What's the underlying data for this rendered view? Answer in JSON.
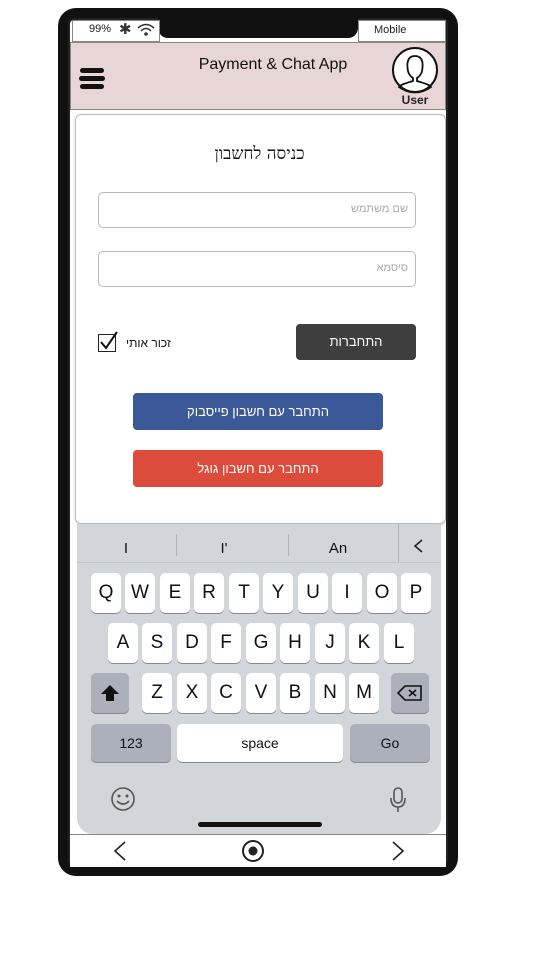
{
  "status_bar": {
    "battery": "99%",
    "network": "Mobile"
  },
  "header": {
    "title": "Payment & Chat App",
    "user_label": "User"
  },
  "login": {
    "title": "כניסה לחשבון",
    "username_placeholder": "שם משתמש",
    "password_placeholder": "סיסמא",
    "login_button": "התחברות",
    "remember_me": "זכור אותי",
    "remember_checked": true,
    "facebook_button": "התחבר עם חשבון פייסבוק",
    "google_button": "התחבר עם חשבון גוגל"
  },
  "colors": {
    "header_bg": "#e8d6d6",
    "facebook": "#3b5998",
    "google": "#dd4b3a",
    "login_button": "#3e3e3e"
  },
  "keyboard": {
    "suggestions": [
      "I",
      "I'",
      "An"
    ],
    "row1": [
      "Q",
      "W",
      "E",
      "R",
      "T",
      "Y",
      "U",
      "I",
      "O",
      "P"
    ],
    "row2": [
      "A",
      "S",
      "D",
      "F",
      "G",
      "H",
      "J",
      "K",
      "L"
    ],
    "row3": [
      "Z",
      "X",
      "C",
      "V",
      "B",
      "N",
      "M"
    ],
    "numbers_key": "123",
    "space_key": "space",
    "go_key": "Go"
  }
}
